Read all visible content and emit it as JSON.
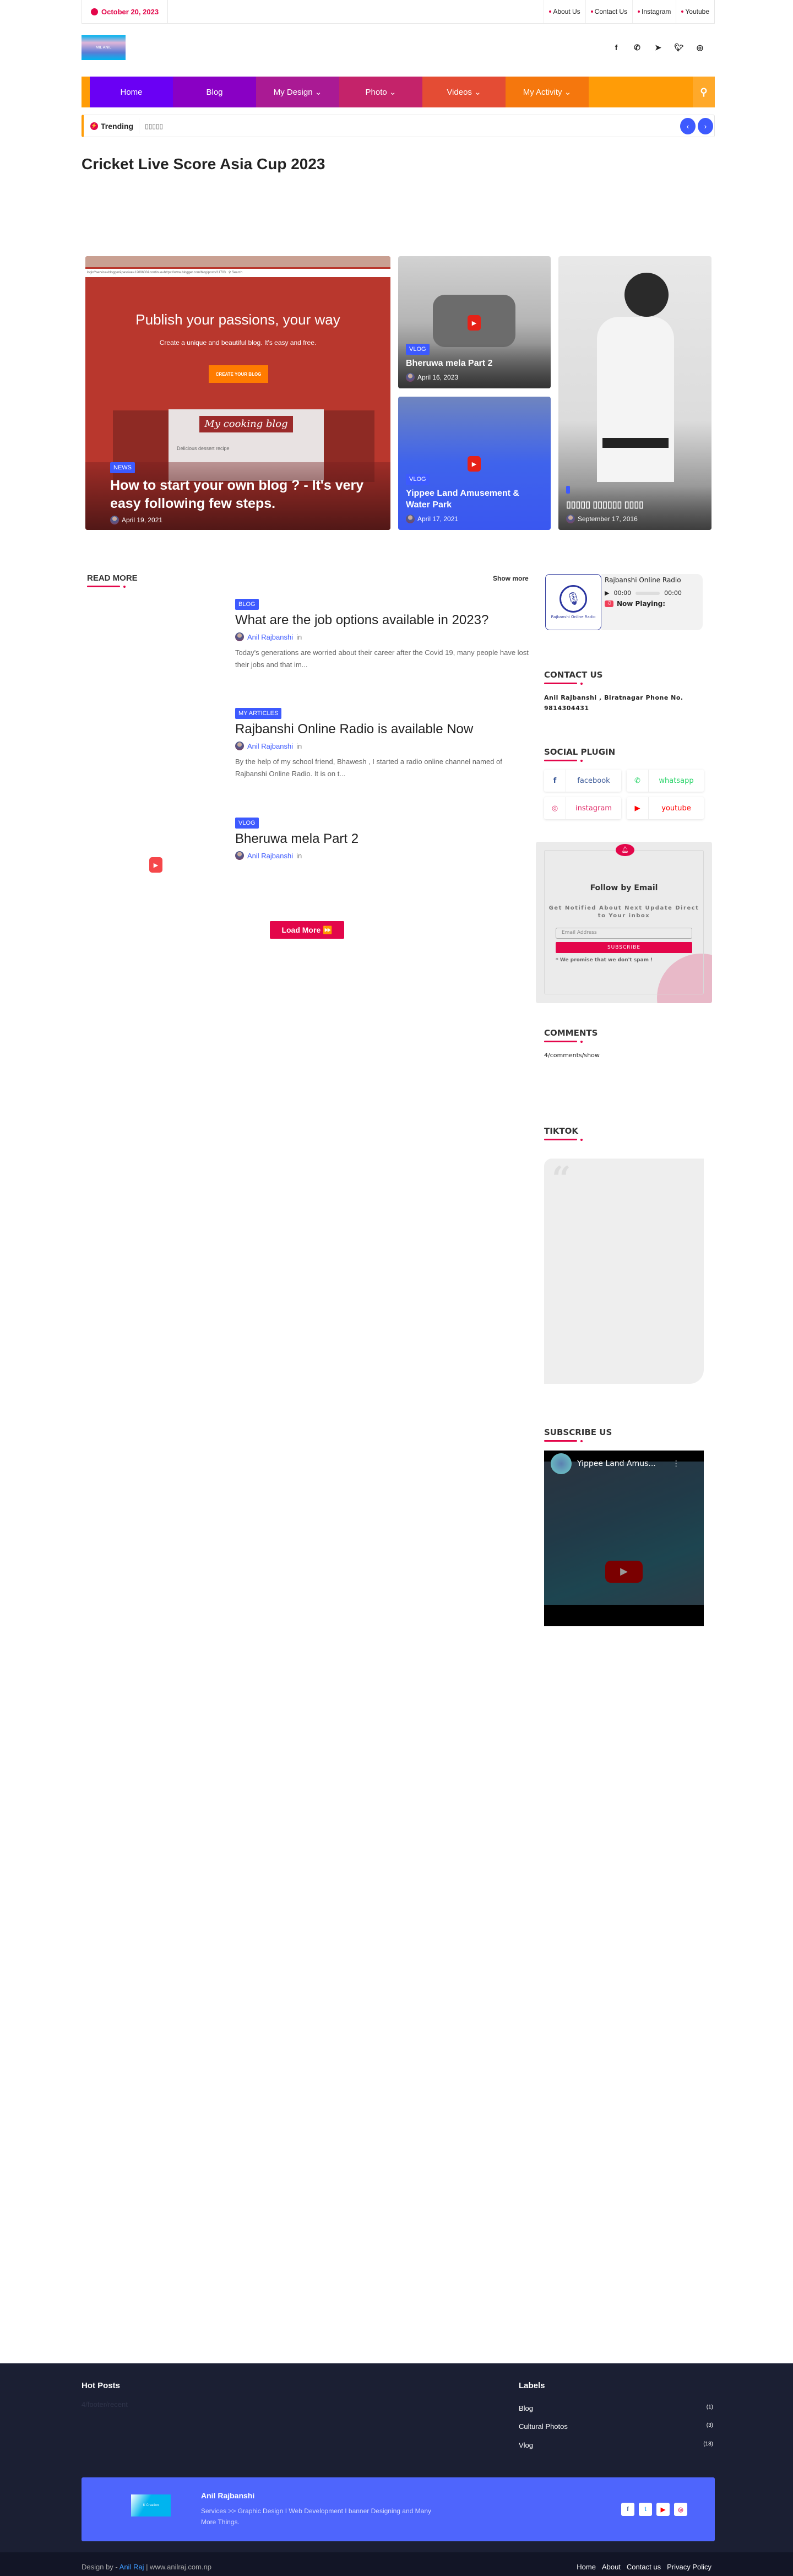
{
  "topbar": {
    "date": "October 20, 2023",
    "links": [
      "About Us",
      "Contact Us",
      "Instagram",
      "Youtube"
    ]
  },
  "header": {
    "logo_text": "MIL ANIL",
    "social_icons": [
      "facebook-icon",
      "whatsapp-icon",
      "telegram-icon",
      "twitter-icon",
      "instagram-icon"
    ]
  },
  "nav": {
    "items": [
      {
        "label": "Home",
        "color": "#6a00f4"
      },
      {
        "label": "Blog",
        "color": "#8900c4"
      },
      {
        "label": "My Design ⌄",
        "color": "#aa1a94"
      },
      {
        "label": "Photo ⌄",
        "color": "#c4236a"
      },
      {
        "label": "Videos ⌄",
        "color": "#e44c34"
      },
      {
        "label": "My Activity ⌄",
        "color": "#f5770d"
      }
    ]
  },
  "trending": {
    "label": "Trending",
    "text": "▯▯▯▯▯"
  },
  "page_title": "Cricket Live Score Asia Cup 2023",
  "featured": [
    {
      "badge": "NEWS",
      "title": "How to start your own blog ? - It's very easy following few steps.",
      "date": "April 19, 2021",
      "image_text": {
        "url": "login?service=blogger&passive=1209600&continue=https://www.blogger.com/blog/posts/11703",
        "search": "Search",
        "headline": "Publish your passions, your way",
        "sub": "Create a unique and beautiful blog. It's easy and free.",
        "cta": "CREATE YOUR BLOG",
        "blog": "My cooking blog",
        "recipe": "Delicious dessert recipe"
      }
    },
    {
      "badge": "VLOG",
      "title": "Bheruwa mela Part 2",
      "date": "April 16, 2023"
    },
    {
      "badge": "VLOG",
      "title": "Yippee Land Amusement & Water Park",
      "date": "April 17, 2021"
    },
    {
      "badge": "",
      "title": "▯▯▯▯▯ ▯▯▯▯▯▯ ▯▯▯▯",
      "date": "September 17, 2016"
    }
  ],
  "read_more": {
    "heading": "READ MORE",
    "show_more": "Show more",
    "load_more": "Load More ⏩",
    "posts": [
      {
        "badge": "BLOG",
        "title": "What are the job options available in 2023?",
        "author": "Anil Rajbanshi",
        "in": "in",
        "excerpt": "Today's generations are worried about their career after the Covid 19, many people have lost their jobs and that im..."
      },
      {
        "badge": "MY ARTICLES",
        "title": "Rajbanshi Online Radio is available Now",
        "author": "Anil Rajbanshi",
        "in": "in",
        "excerpt": "By the help of my school friend, Bhawesh , I started a radio online channel named of Rajbanshi Online Radio. It is on t..."
      },
      {
        "badge": "VLOG",
        "title": "Bheruwa mela Part 2",
        "author": "Anil Rajbanshi",
        "in": "in",
        "excerpt": ""
      }
    ]
  },
  "sidebar": {
    "radio": {
      "logo_text": "Rajbanshi Online Radio",
      "title": "Rajbanshi Online Radio",
      "time_current": "00:00",
      "time_total": "00:00",
      "now_playing": "Now Playing:"
    },
    "contact": {
      "heading": "CONTACT US",
      "text": "Anil Rajbanshi , Biratnagar Phone No. 9814304431"
    },
    "social": {
      "heading": "SOCIAL PLUGIN",
      "items": [
        {
          "label": "facebook",
          "color": "#3b5998"
        },
        {
          "label": "whatsapp",
          "color": "#25d366"
        },
        {
          "label": "instagram",
          "color": "#e1306c"
        },
        {
          "label": "youtube",
          "color": "#ff0000"
        }
      ]
    },
    "follow": {
      "title": "Follow by Email",
      "subtitle": "Get Notified About Next Update Direct to Your inbox",
      "placeholder": "Email Address",
      "button": "SUBSCRIBE",
      "note": "* We promise that we don't spam !"
    },
    "comments": {
      "heading": "COMMENTS",
      "text": "4/comments/show"
    },
    "tiktok": {
      "heading": "TIKTOK"
    },
    "subscribe": {
      "heading": "SUBSCRIBE US",
      "video_title": "Yippee Land Amus..."
    }
  },
  "footer": {
    "hot_posts": "Hot Posts",
    "hot_posts_text": "4/footer/recent",
    "labels_heading": "Labels",
    "labels": [
      {
        "name": "Blog",
        "count": "(1)"
      },
      {
        "name": "Cultural Photos",
        "count": "(3)"
      },
      {
        "name": "Vlog",
        "count": "(18)"
      }
    ],
    "about": {
      "logo_text": "K Creation",
      "name": "Anil Rajbanshi",
      "text": "Services >> Graphic Design I Web Development I banner Designing and Many More Things."
    },
    "credit": {
      "prefix": "Design by - ",
      "name": "Anil Raj",
      "suffix": " | www.anilraj.com.np"
    },
    "links": [
      "Home",
      "About",
      "Contact us",
      "Privacy Policy"
    ]
  },
  "colors": {
    "accent": "#e3064a",
    "blue": "#3d5afe",
    "orange": "#ff9c07",
    "footer_bg": "#1b1f33",
    "band": "#4e65fd"
  }
}
